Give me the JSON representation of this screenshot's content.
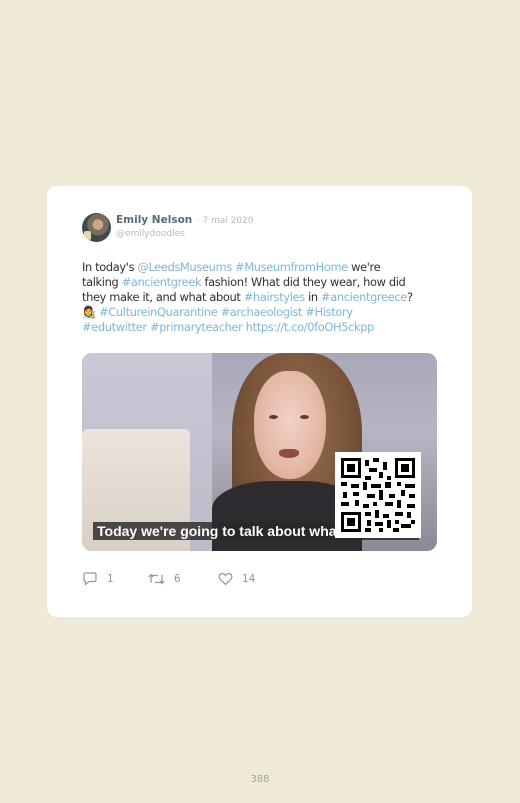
{
  "tweet": {
    "author_name": "Emily Nelson",
    "separator": "·",
    "date": "7 mai 2020",
    "handle": "@emilydoodles",
    "lines": [
      [
        {
          "t": "In today's ",
          "link": false
        },
        {
          "t": "@LeedsMuseums",
          "link": true
        },
        {
          "t": " ",
          "link": false
        },
        {
          "t": "#MuseumfromHome",
          "link": true
        },
        {
          "t": " we're",
          "link": false
        }
      ],
      [
        {
          "t": "talking ",
          "link": false
        },
        {
          "t": "#ancientgreek",
          "link": true
        },
        {
          "t": " fashion! What did they wear, how did",
          "link": false
        }
      ],
      [
        {
          "t": "they make it, and what about ",
          "link": false
        },
        {
          "t": "#hairstyles",
          "link": true
        },
        {
          "t": " in ",
          "link": false
        },
        {
          "t": "#ancientgreece",
          "link": true
        },
        {
          "t": "?",
          "link": false
        }
      ],
      [
        {
          "t": "👩‍🎨 ",
          "link": false
        },
        {
          "t": "#CultureinQuarantine",
          "link": true
        },
        {
          "t": " ",
          "link": false
        },
        {
          "t": "#archaeologist",
          "link": true
        },
        {
          "t": " ",
          "link": false
        },
        {
          "t": "#History",
          "link": true
        }
      ],
      [
        {
          "t": "#edutwitter",
          "link": true
        },
        {
          "t": " ",
          "link": false
        },
        {
          "t": "#primaryteacher",
          "link": true
        },
        {
          "t": " ",
          "link": false
        },
        {
          "t": "https://t.co/0foOH5ckpp",
          "link": true
        }
      ]
    ]
  },
  "media": {
    "caption": "Today we're going to talk about what"
  },
  "actions": {
    "reply_count": "1",
    "retweet_count": "6",
    "like_count": "14"
  },
  "icons": {
    "reply": "reply-icon",
    "retweet": "retweet-icon",
    "like": "heart-icon"
  },
  "colors": {
    "link": "#7fb6d6",
    "background": "#efe9d8",
    "card": "#ffffff"
  },
  "footer": {
    "page_number": "388"
  }
}
